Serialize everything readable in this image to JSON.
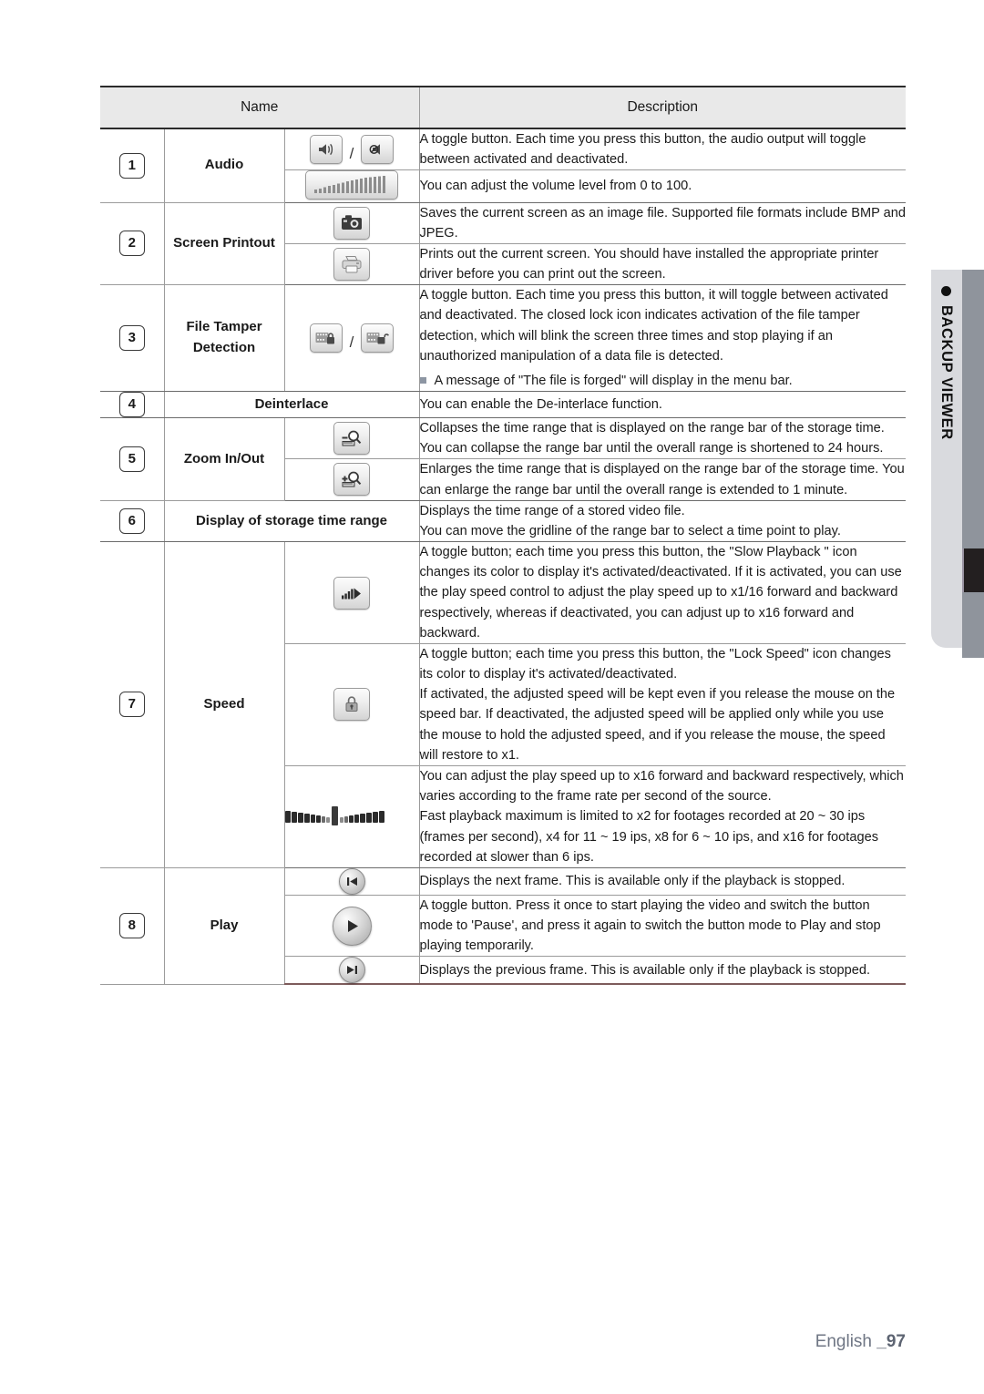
{
  "page": {
    "footer_language": "English ",
    "footer_page": "_97"
  },
  "side_tab": {
    "label": "BACKUP VIEWER",
    "dot_icon": "bullet-dot-icon",
    "colors": {
      "tab_bg": "#d9dade",
      "bar_gray": "#8f949c",
      "bar_dark": "#231f20"
    }
  },
  "table": {
    "headers": {
      "name": "Name",
      "description": "Description"
    },
    "rows": [
      {
        "number": "1",
        "name": "Audio",
        "items": [
          {
            "icon": "speaker-on-off-icons",
            "description": "A toggle button. Each time you press this button, the audio output will toggle between activated and deactivated."
          },
          {
            "icon": "volume-slider-icon",
            "description": "You can adjust the volume level from 0 to 100."
          }
        ]
      },
      {
        "number": "2",
        "name": "Screen Printout",
        "items": [
          {
            "icon": "camera-icon",
            "description": "Saves the current screen as an image file. Supported file formats include BMP and JPEG."
          },
          {
            "icon": "printer-icon",
            "description": "Prints out the current screen. You should have installed the appropriate printer driver before you can print out the screen."
          }
        ]
      },
      {
        "number": "3",
        "name": "File Tamper Detection",
        "name_line1": "File Tamper",
        "name_line2": "Detection",
        "items": [
          {
            "icon": "film-lock-closed-open-icons",
            "description": "A toggle button. Each time you press this button, it will toggle between activated and deactivated. The closed lock icon indicates activation of the file tamper detection, which will blink the screen three times and stop playing if an unauthorized manipulation of a data file is detected.",
            "bullet": "A message of \"The file is forged\" will display in the menu bar."
          }
        ]
      },
      {
        "number": "4",
        "name": "Deinterlace",
        "name_spans_icon_column": true,
        "items": [
          {
            "icon": "",
            "description": "You can enable the De-interlace function."
          }
        ]
      },
      {
        "number": "5",
        "name": "Zoom In/Out",
        "items": [
          {
            "icon": "zoom-out-icon",
            "description": "Collapses the time range that is displayed on the range bar of the storage time. You can collapse the range bar until the overall range is shortened to 24 hours."
          },
          {
            "icon": "zoom-in-icon",
            "description": "Enlarges the time range that is displayed on the range bar of the storage time. You can enlarge the range bar until the overall range is extended to 1 minute."
          }
        ]
      },
      {
        "number": "6",
        "name": "Display of storage time range",
        "name_spans_icon_column": true,
        "items": [
          {
            "icon": "",
            "description": "Displays the time range of a stored video file.",
            "description2": "You can move the gridline of the range bar to select a time point to play."
          }
        ]
      },
      {
        "number": "7",
        "name": "Speed",
        "items": [
          {
            "icon": "slow-playback-icon",
            "description": "A toggle button; each time you press this button, the \"Slow Playback \" icon changes its color to display it's activated/deactivated. If it is activated, you can use the play speed control to adjust the play speed up to x1/16 forward and backward respectively, whereas if deactivated, you can adjust up to x16 forward and backward."
          },
          {
            "icon": "lock-speed-icon",
            "description": "A toggle button; each time you press this button, the \"Lock Speed\" icon changes its color to display it's activated/deactivated.",
            "description2": "If activated, the adjusted speed will be kept even if you release the mouse on the speed bar. If deactivated, the adjusted speed will be applied only while you use the mouse to hold the adjusted speed, and if you release the mouse, the speed will restore to x1."
          },
          {
            "icon": "speed-bar-icon",
            "description": "You can adjust the play speed up to x16 forward and backward respectively, which varies according to the frame rate per second of the source.",
            "description2": "Fast playback maximum is limited to x2 for footages recorded at 20 ~ 30 ips (frames per second), x4 for 11 ~ 19 ips, x8 for 6 ~ 10 ips, and x16 for footages recorded at slower than 6 ips."
          }
        ]
      },
      {
        "number": "8",
        "name": "Play",
        "items": [
          {
            "icon": "next-frame-icon",
            "description": "Displays the next frame. This is available only if the playback is stopped."
          },
          {
            "icon": "play-icon",
            "description": "A toggle button. Press it once to start playing the video and switch the button mode to 'Pause', and press it again to switch the button mode to Play and stop playing temporarily."
          },
          {
            "icon": "previous-frame-icon",
            "description": "Displays the previous frame. This is available only if the playback is stopped."
          }
        ]
      }
    ]
  }
}
